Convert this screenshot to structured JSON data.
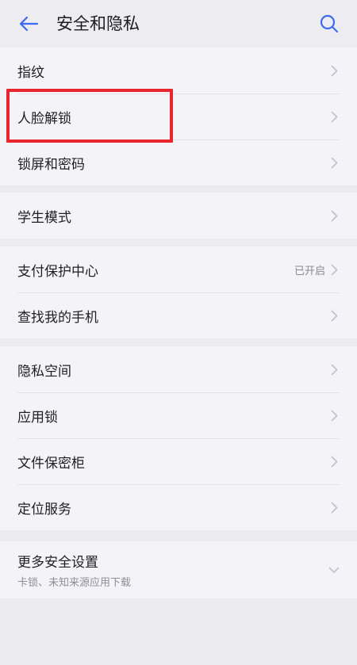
{
  "header": {
    "title": "安全和隐私"
  },
  "groups": [
    {
      "items": [
        {
          "label": "指纹"
        },
        {
          "label": "人脸解锁"
        },
        {
          "label": "锁屏和密码"
        }
      ]
    },
    {
      "items": [
        {
          "label": "学生模式"
        }
      ]
    },
    {
      "items": [
        {
          "label": "支付保护中心",
          "status": "已开启"
        },
        {
          "label": "查找我的手机"
        }
      ]
    },
    {
      "items": [
        {
          "label": "隐私空间"
        },
        {
          "label": "应用锁"
        },
        {
          "label": "文件保密柜"
        },
        {
          "label": "定位服务"
        }
      ]
    },
    {
      "items": [
        {
          "label": "更多安全设置",
          "subtitle": "卡锁、未知来源应用下载"
        }
      ]
    }
  ],
  "colors": {
    "accent": "#3b6cf0",
    "highlight": "#e8262b"
  },
  "icons": {
    "back": "arrow-left-icon",
    "search": "search-icon",
    "chevron_right": "chevron-right-icon",
    "chevron_down": "chevron-down-icon"
  }
}
